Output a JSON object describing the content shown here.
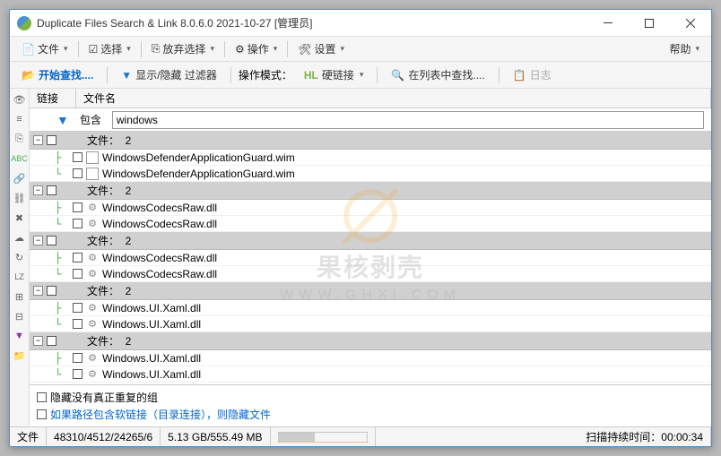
{
  "title": "Duplicate Files Search & Link 8.0.6.0 2021-10-27 [管理员]",
  "menu": {
    "file": "文件",
    "select": "选择",
    "deselect": "放弃选择",
    "action": "操作",
    "settings": "设置",
    "help": "帮助"
  },
  "toolbar": {
    "start": "开始查找....",
    "filter": "显示/隐藏 过滤器",
    "mode_label": "操作模式：",
    "hardlink": "硬链接",
    "searchlist": "在列表中查找....",
    "log": "日志"
  },
  "grid": {
    "col1": "链接",
    "col2": "文件名"
  },
  "filter": {
    "label": "包含",
    "value": "windows"
  },
  "group_label": "文件：",
  "group_count": "2",
  "groups": [
    {
      "files": [
        "WindowsDefenderApplicationGuard.wim",
        "WindowsDefenderApplicationGuard.wim"
      ],
      "type": "wim"
    },
    {
      "files": [
        "WindowsCodecsRaw.dll",
        "WindowsCodecsRaw.dll"
      ],
      "type": "dll"
    },
    {
      "files": [
        "WindowsCodecsRaw.dll",
        "WindowsCodecsRaw.dll"
      ],
      "type": "dll"
    },
    {
      "files": [
        "Windows.UI.Xaml.dll",
        "Windows.UI.Xaml.dll"
      ],
      "type": "dll"
    },
    {
      "files": [
        "Windows.UI.Xaml.dll",
        "Windows.UI.Xaml.dll"
      ],
      "type": "dll"
    }
  ],
  "options": {
    "opt1": "隐藏没有真正重复的组",
    "opt2": "如果路径包含软链接（目录连接），则隐藏文件"
  },
  "status": {
    "files": "文件",
    "counts": "48310/4512/24265/6",
    "size": "5.13 GB/555.49 MB",
    "scan_label": "扫描持续时间：",
    "scan_time": "00:00:34"
  },
  "watermark": {
    "t1": "果核剥壳",
    "t2": "WWW.GHXI.COM"
  }
}
